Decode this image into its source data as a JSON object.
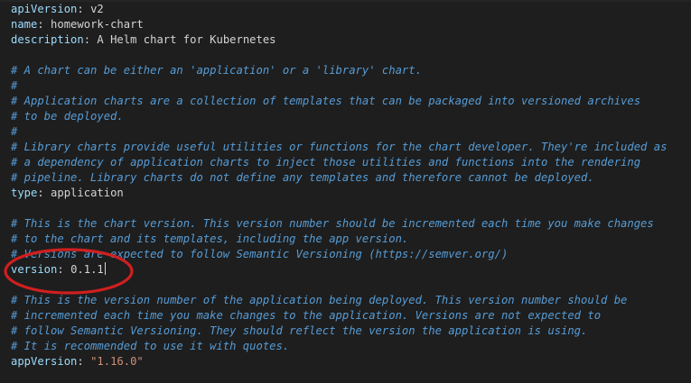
{
  "file": {
    "lines": [
      {
        "type": "kv",
        "key": "apiVersion",
        "value": "v2",
        "value_kind": "plain"
      },
      {
        "type": "kv",
        "key": "name",
        "value": "homework-chart",
        "value_kind": "plain"
      },
      {
        "type": "kv",
        "key": "description",
        "value": "A Helm chart for Kubernetes",
        "value_kind": "plain"
      },
      {
        "type": "blank"
      },
      {
        "type": "comment",
        "text": "# A chart can be either an 'application' or a 'library' chart."
      },
      {
        "type": "comment",
        "text": "#"
      },
      {
        "type": "comment",
        "text": "# Application charts are a collection of templates that can be packaged into versioned archives"
      },
      {
        "type": "comment",
        "text": "# to be deployed."
      },
      {
        "type": "comment",
        "text": "#"
      },
      {
        "type": "comment",
        "text": "# Library charts provide useful utilities or functions for the chart developer. They're included as"
      },
      {
        "type": "comment",
        "text": "# a dependency of application charts to inject those utilities and functions into the rendering"
      },
      {
        "type": "comment",
        "text": "# pipeline. Library charts do not define any templates and therefore cannot be deployed."
      },
      {
        "type": "kv",
        "key": "type",
        "value": "application",
        "value_kind": "plain"
      },
      {
        "type": "blank"
      },
      {
        "type": "comment",
        "text": "# This is the chart version. This version number should be incremented each time you make changes"
      },
      {
        "type": "comment",
        "text": "# to the chart and its templates, including the app version."
      },
      {
        "type": "comment",
        "text": "# Versions are expected to follow Semantic Versioning (https://semver.org/)"
      },
      {
        "type": "kv",
        "key": "version",
        "value": "0.1.1",
        "value_kind": "plain",
        "cursor": true
      },
      {
        "type": "blank"
      },
      {
        "type": "comment",
        "text": "# This is the version number of the application being deployed. This version number should be"
      },
      {
        "type": "comment",
        "text": "# incremented each time you make changes to the application. Versions are not expected to"
      },
      {
        "type": "comment",
        "text": "# follow Semantic Versioning. They should reflect the version the application is using."
      },
      {
        "type": "comment",
        "text": "# It is recommended to use it with quotes."
      },
      {
        "type": "kv",
        "key": "appVersion",
        "value": "\"1.16.0\"",
        "value_kind": "string"
      }
    ]
  },
  "colors": {
    "background": "#1e1e1e",
    "key": "#9cdcfe",
    "comment": "#569cd6",
    "string": "#ce9178",
    "text": "#d4d4d4",
    "annotation": "#d01f1f"
  }
}
